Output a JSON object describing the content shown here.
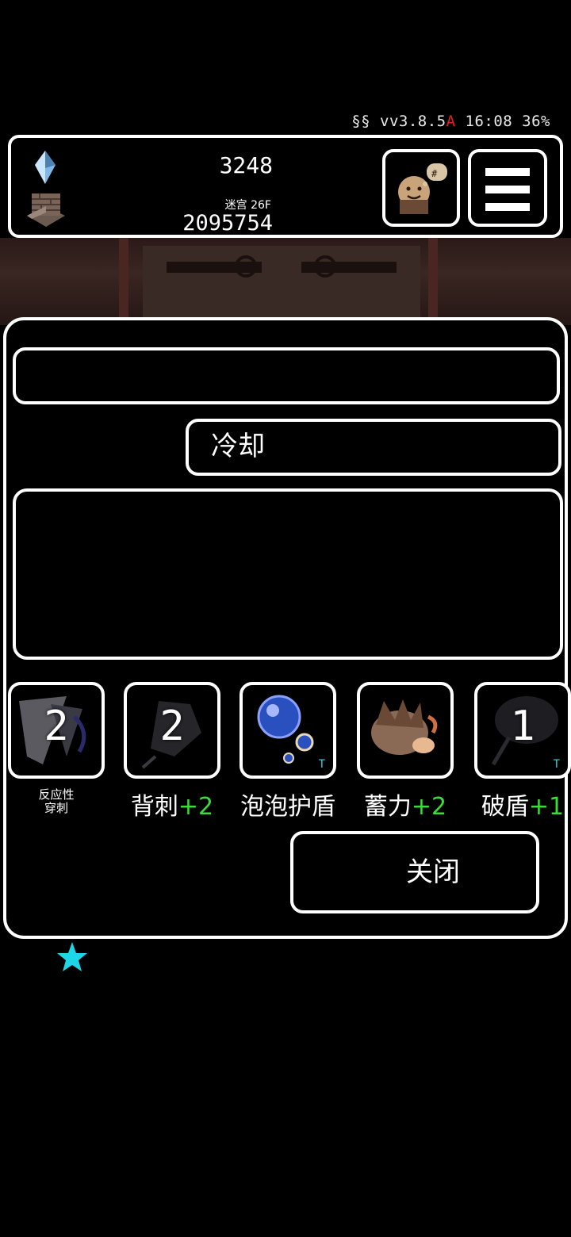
{
  "status": {
    "prefix": "§§ vv3.8.5",
    "warn": "A",
    "time": "16:08",
    "battery": "36%"
  },
  "resources": {
    "gems": "3248",
    "floor": "迷宫 26F",
    "gold": "2095754"
  },
  "panel": {
    "title": "",
    "tag": "冷却",
    "description": "",
    "skills": [
      {
        "level": "2",
        "name": "反应性",
        "name2": "穿刺",
        "bonus": "",
        "tier_mark": ""
      },
      {
        "level": "2",
        "name": "背刺",
        "bonus": "+2",
        "tier_mark": ""
      },
      {
        "level": "",
        "name": "泡泡护盾",
        "bonus": "",
        "tier_mark": "T"
      },
      {
        "level": "",
        "name": "蓄力",
        "bonus": "+2",
        "tier_mark": ""
      },
      {
        "level": "1",
        "name": "破盾",
        "bonus": "+1",
        "tier_mark": "T"
      }
    ],
    "close_label": "关闭"
  },
  "colors": {
    "accent_green": "#3adc3a",
    "accent_cyan": "#1fd6e6",
    "warn_red": "#e02020"
  }
}
